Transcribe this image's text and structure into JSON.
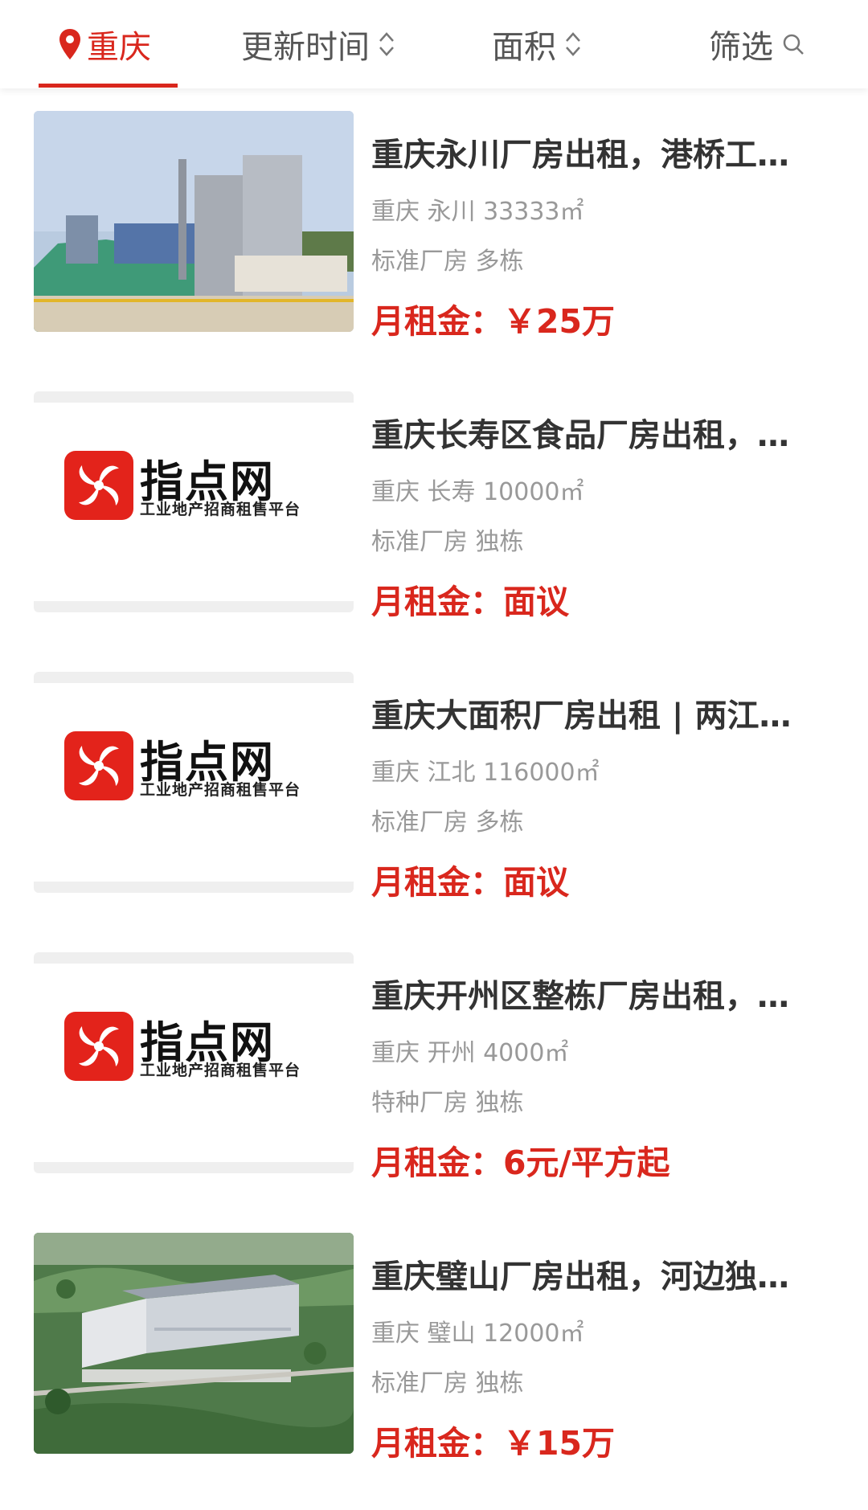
{
  "filter_bar": {
    "city": "重庆",
    "sort_time": "更新时间",
    "sort_area": "面积",
    "filter": "筛选"
  },
  "logo": {
    "name": "指点网",
    "slogan": "工业地产招商租售平台"
  },
  "listings": [
    {
      "title": "重庆永川厂房出租，港桥工业园标准厂房",
      "meta": "重庆 永川 33333㎡",
      "tags": "标准厂房 多栋",
      "price_label": "月租金：",
      "price": "￥25万"
    },
    {
      "title": "重庆长寿区食品厂房出租，独栋带办公",
      "meta": "重庆 长寿 10000㎡",
      "tags": "标准厂房 独栋",
      "price_label": "月租金：",
      "price": "面议"
    },
    {
      "title": "重庆大面积厂房出租 | 两江新区",
      "meta": "重庆 江北 116000㎡",
      "tags": "标准厂房 多栋",
      "price_label": "月租金：",
      "price": "面议"
    },
    {
      "title": "重庆开州区整栋厂房出租，可分租",
      "meta": "重庆 开州 4000㎡",
      "tags": "特种厂房 独栋",
      "price_label": "月租金：",
      "price": "6元/平方起"
    },
    {
      "title": "重庆璧山厂房出租，河边独栋厂房",
      "meta": "重庆 璧山 12000㎡",
      "tags": "标准厂房 独栋",
      "price_label": "月租金：",
      "price": "￥15万"
    }
  ],
  "colors": {
    "accent": "#d9271d",
    "title": "#333333",
    "muted": "#999999"
  },
  "icons": [
    "location-pin-icon",
    "sort-updown-icon",
    "search-icon"
  ]
}
